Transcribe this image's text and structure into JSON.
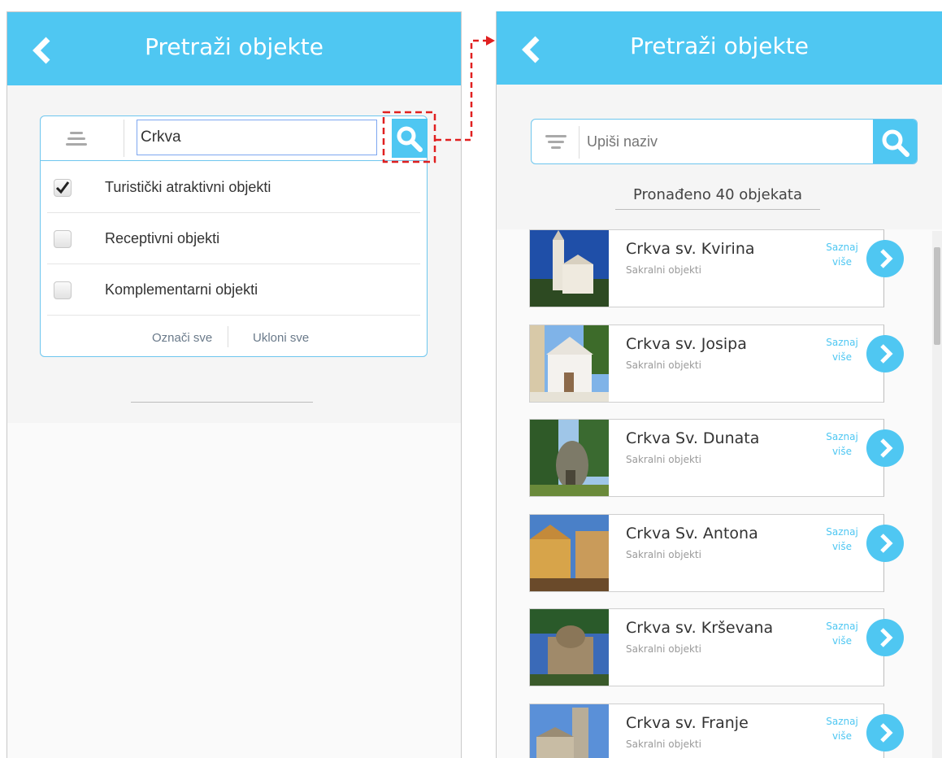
{
  "left_screen": {
    "header": {
      "title": "Pretraži objekte"
    },
    "search": {
      "value": "Crkva"
    },
    "filters": [
      {
        "label": "Turistički atraktivni objekti",
        "checked": true
      },
      {
        "label": "Receptivni objekti",
        "checked": false
      },
      {
        "label": "Komplementarni objekti",
        "checked": false
      }
    ],
    "select_all": "Označi sve",
    "remove_all": "Ukloni sve"
  },
  "right_screen": {
    "header": {
      "title": "Pretraži objekte"
    },
    "search": {
      "placeholder": "Upiši naziv"
    },
    "result_count": "Pronađeno 40 objekata",
    "items": [
      {
        "title": "Crkva sv. Kvirina",
        "category": "Sakralni objekti",
        "more_line1": "Saznaj",
        "more_line2": "više"
      },
      {
        "title": "Crkva sv. Josipa",
        "category": "Sakralni objekti",
        "more_line1": "Saznaj",
        "more_line2": "više"
      },
      {
        "title": "Crkva Sv. Dunata",
        "category": "Sakralni objekti",
        "more_line1": "Saznaj",
        "more_line2": "više"
      },
      {
        "title": "Crkva Sv. Antona",
        "category": "Sakralni objekti",
        "more_line1": "Saznaj",
        "more_line2": "više"
      },
      {
        "title": "Crkva sv. Krševana",
        "category": "Sakralni objekti",
        "more_line1": "Saznaj",
        "more_line2": "više"
      },
      {
        "title": "Crkva sv. Franje",
        "category": "Sakralni objekti",
        "more_line1": "Saznaj",
        "more_line2": "više"
      }
    ]
  },
  "colors": {
    "accent": "#4fc7f2",
    "annotation": "#e02020"
  }
}
